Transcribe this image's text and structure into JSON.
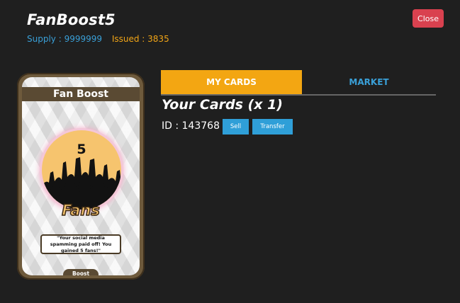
{
  "app": {
    "title": "FanBoost5"
  },
  "stats": {
    "supply": "Supply : 9999999",
    "issued": "Issued : 3835"
  },
  "header": {
    "close_label": "Close"
  },
  "card": {
    "name": "Fan Boost",
    "number": "5",
    "caption": "Fans",
    "quote": "\"Your social media spamming paid off! You gained 5 fans!\"",
    "type": "Boost"
  },
  "tabs": [
    {
      "label": "MY CARDS",
      "active": true
    },
    {
      "label": "MARKET",
      "active": false
    }
  ],
  "cards_panel": {
    "heading": "Your Cards (x 1)",
    "id_text": "ID : 143768",
    "sell_label": "Sell",
    "transfer_label": "Transfer"
  },
  "colors": {
    "background": "#1f1f1f",
    "accent_orange": "#f3a612",
    "accent_blue": "#2f9fd8",
    "close_red": "#d9414f"
  }
}
